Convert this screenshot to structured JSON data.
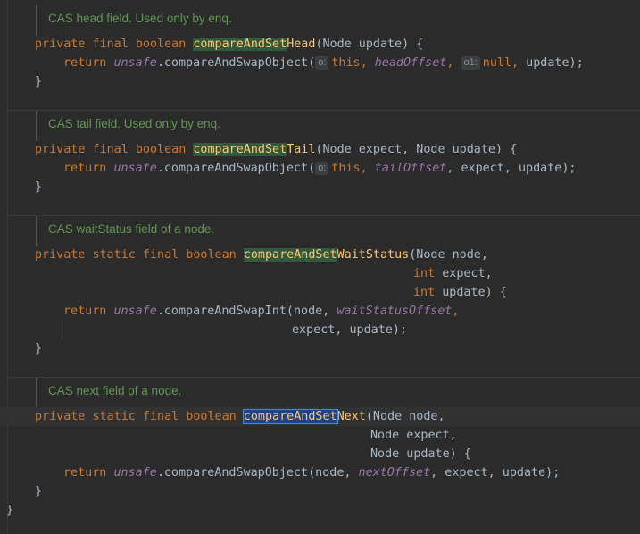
{
  "blocks": [
    {
      "doc": "CAS head field. Used only by enq.",
      "sig": {
        "kw": "private final boolean ",
        "hl": "compareAndSet",
        "name_rest": "Head",
        "params": "(Node update) {"
      },
      "ret": {
        "kw": "return ",
        "unsafe": "unsafe",
        "call": ".compareAndSwapObject(",
        "hint1": "o:",
        "this": "this",
        "c1": ", ",
        "field": "headOffset",
        "c2": ", ",
        "hint2": "o1:",
        "nullv": "null",
        "c3": ", ",
        "tail": "update);"
      },
      "close": "}"
    },
    {
      "doc": "CAS tail field. Used only by enq.",
      "sig": {
        "kw": "private final boolean ",
        "hl": "compareAndSet",
        "name_rest": "Tail",
        "params": "(Node expect, Node update) {"
      },
      "ret": {
        "kw": "return ",
        "unsafe": "unsafe",
        "call": ".compareAndSwapObject(",
        "hint1": "o:",
        "this": "this",
        "c1": ", ",
        "field": "tailOffset",
        "tail": ", expect, update);"
      },
      "close": "}"
    },
    {
      "doc": "CAS waitStatus field of a node.",
      "sig": {
        "kw": "private static final boolean ",
        "hl": "compareAndSet",
        "name_rest": "WaitStatus",
        "params": "(Node node,"
      },
      "cont1": {
        "kw": "int",
        "rest": " expect,"
      },
      "cont2": {
        "kw": "int",
        "rest": " update) {"
      },
      "ret": {
        "kw": "return ",
        "unsafe": "unsafe",
        "call": ".compareAndSwapInt(node, ",
        "field": "waitStatusOffset",
        "tail": ","
      },
      "ret2": "expect, update);",
      "close": "}"
    },
    {
      "doc": "CAS next field of a node.",
      "sig": {
        "kw": "private static final boolean ",
        "hl": "compareAndSet",
        "name_rest": "Next",
        "params": "(Node node,"
      },
      "cont1": {
        "rest": "Node expect,"
      },
      "cont2": {
        "rest": "Node update) {"
      },
      "ret": {
        "kw": "return ",
        "unsafe": "unsafe",
        "call": ".compareAndSwapObject(node, ",
        "field": "nextOffset",
        "tail": ", expect, update);"
      },
      "close": "}"
    }
  ],
  "class_close": "}"
}
